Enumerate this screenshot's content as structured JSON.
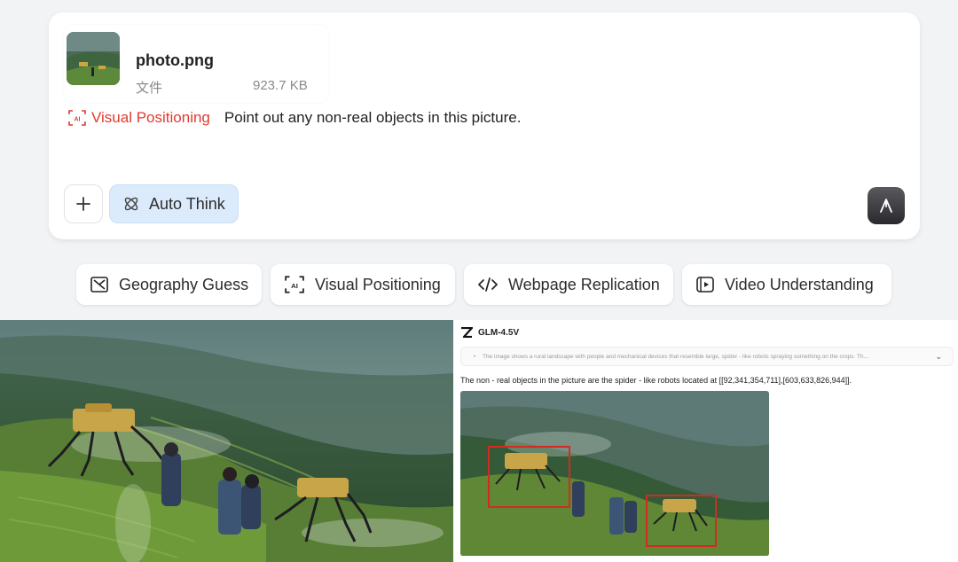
{
  "composer": {
    "attachment": {
      "file_name": "photo.png",
      "file_type": "文件",
      "file_size": "923.7 KB"
    },
    "prompt_tag": "Visual Positioning",
    "prompt_text": "Point out any non-real objects in this picture.",
    "auto_think_label": "Auto Think"
  },
  "suggestions": [
    {
      "label": "Geography Guess",
      "icon": "image-landscape-icon"
    },
    {
      "label": "Visual Positioning",
      "icon": "ai-bracket-icon"
    },
    {
      "label": "Webpage Replication",
      "icon": "code-icon"
    },
    {
      "label": "Video Understanding",
      "icon": "video-icon"
    }
  ],
  "result": {
    "model_name": "GLM-4.5V",
    "thinking_summary": "The image shows a rural landscape with people and mechanical devices that resemble large, spider - like robots spraying something on the crops. Th...",
    "answer": "The non - real objects in the picture are the spider - like robots located at [[92,341,354,711],[603,633,826,944]]."
  },
  "colors": {
    "accent_red": "#e03a2f",
    "think_bg": "#dcebfb",
    "box_red": "#d42a22"
  }
}
